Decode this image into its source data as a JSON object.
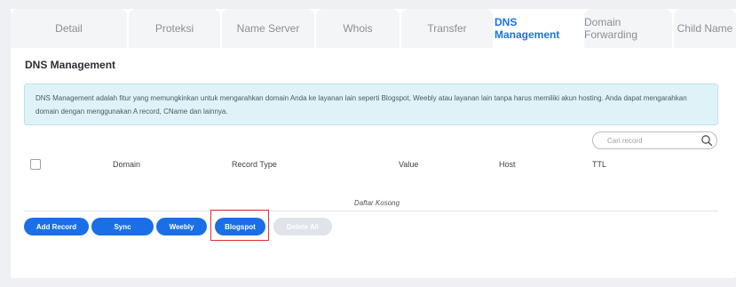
{
  "tabs": [
    {
      "label": "Detail",
      "active": false
    },
    {
      "label": "Proteksi",
      "active": false
    },
    {
      "label": "Name Server",
      "active": false
    },
    {
      "label": "Whois",
      "active": false
    },
    {
      "label": "Transfer",
      "active": false
    },
    {
      "label": "DNS Management",
      "active": true
    },
    {
      "label": "Domain Forwarding",
      "active": false
    },
    {
      "label": "Child Name",
      "active": false
    }
  ],
  "section": {
    "title": "DNS Management",
    "info": "DNS Management adalah fitur yang memungkinkan untuk mengarahkan domain Anda ke layanan lain seperti Blogspot, Weebly atau layanan lain tanpa harus memiliki akun hosting. Anda dapat mengarahkan domain dengan menggunakan A record, CName dan lainnya."
  },
  "search": {
    "placeholder": "Cari record"
  },
  "table": {
    "headers": [
      "Domain",
      "Record Type",
      "Value",
      "Host",
      "TTL"
    ],
    "empty_text": "Daftar Kosong"
  },
  "buttons": {
    "add_record": "Add Record",
    "sync": "Sync",
    "weebly": "Weebly",
    "blogspot": "Blogspot",
    "delete_all": "Delete All"
  },
  "colors": {
    "accent": "#1a73e8",
    "button": "#1a6fe6",
    "info_bg": "#dff2f7",
    "highlight": "#e0302f"
  }
}
